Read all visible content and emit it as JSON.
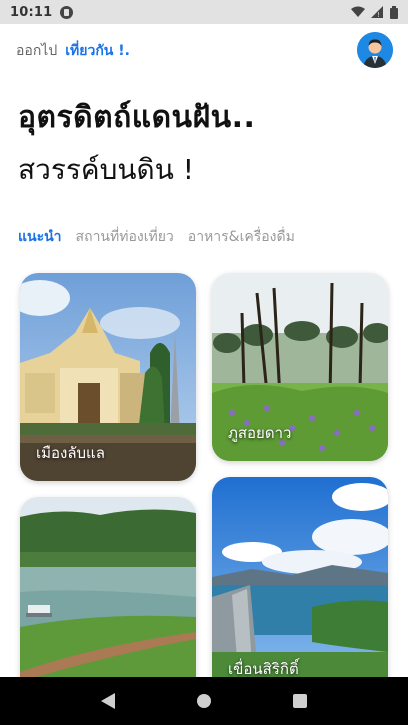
{
  "status_bar": {
    "time": "10:11"
  },
  "header": {
    "exit_label": "ออกไป",
    "go_label": "เที่ยวกัน !."
  },
  "hero": {
    "title": "อุตรดิตถ์แดนฝัน..",
    "subtitle": "สวรรค์บนดิน !"
  },
  "tabs": [
    {
      "label": "แนะนำ",
      "active": true
    },
    {
      "label": "สถานที่ท่องเที่ยว",
      "active": false
    },
    {
      "label": "อาหาร&เครื่องดื่ม",
      "active": false
    }
  ],
  "places": [
    {
      "name": "เมืองลับแล",
      "image": "temple-gate"
    },
    {
      "name": "ภูสอยดาว",
      "image": "pine-meadow"
    },
    {
      "name": "",
      "image": "lake-houseboat"
    },
    {
      "name": "เขื่อนสิริกิติ์",
      "image": "dam-reservoir"
    }
  ],
  "colors": {
    "accent": "#1a73e8",
    "statusbar": "#e2e2e2",
    "navbar": "#000000"
  }
}
